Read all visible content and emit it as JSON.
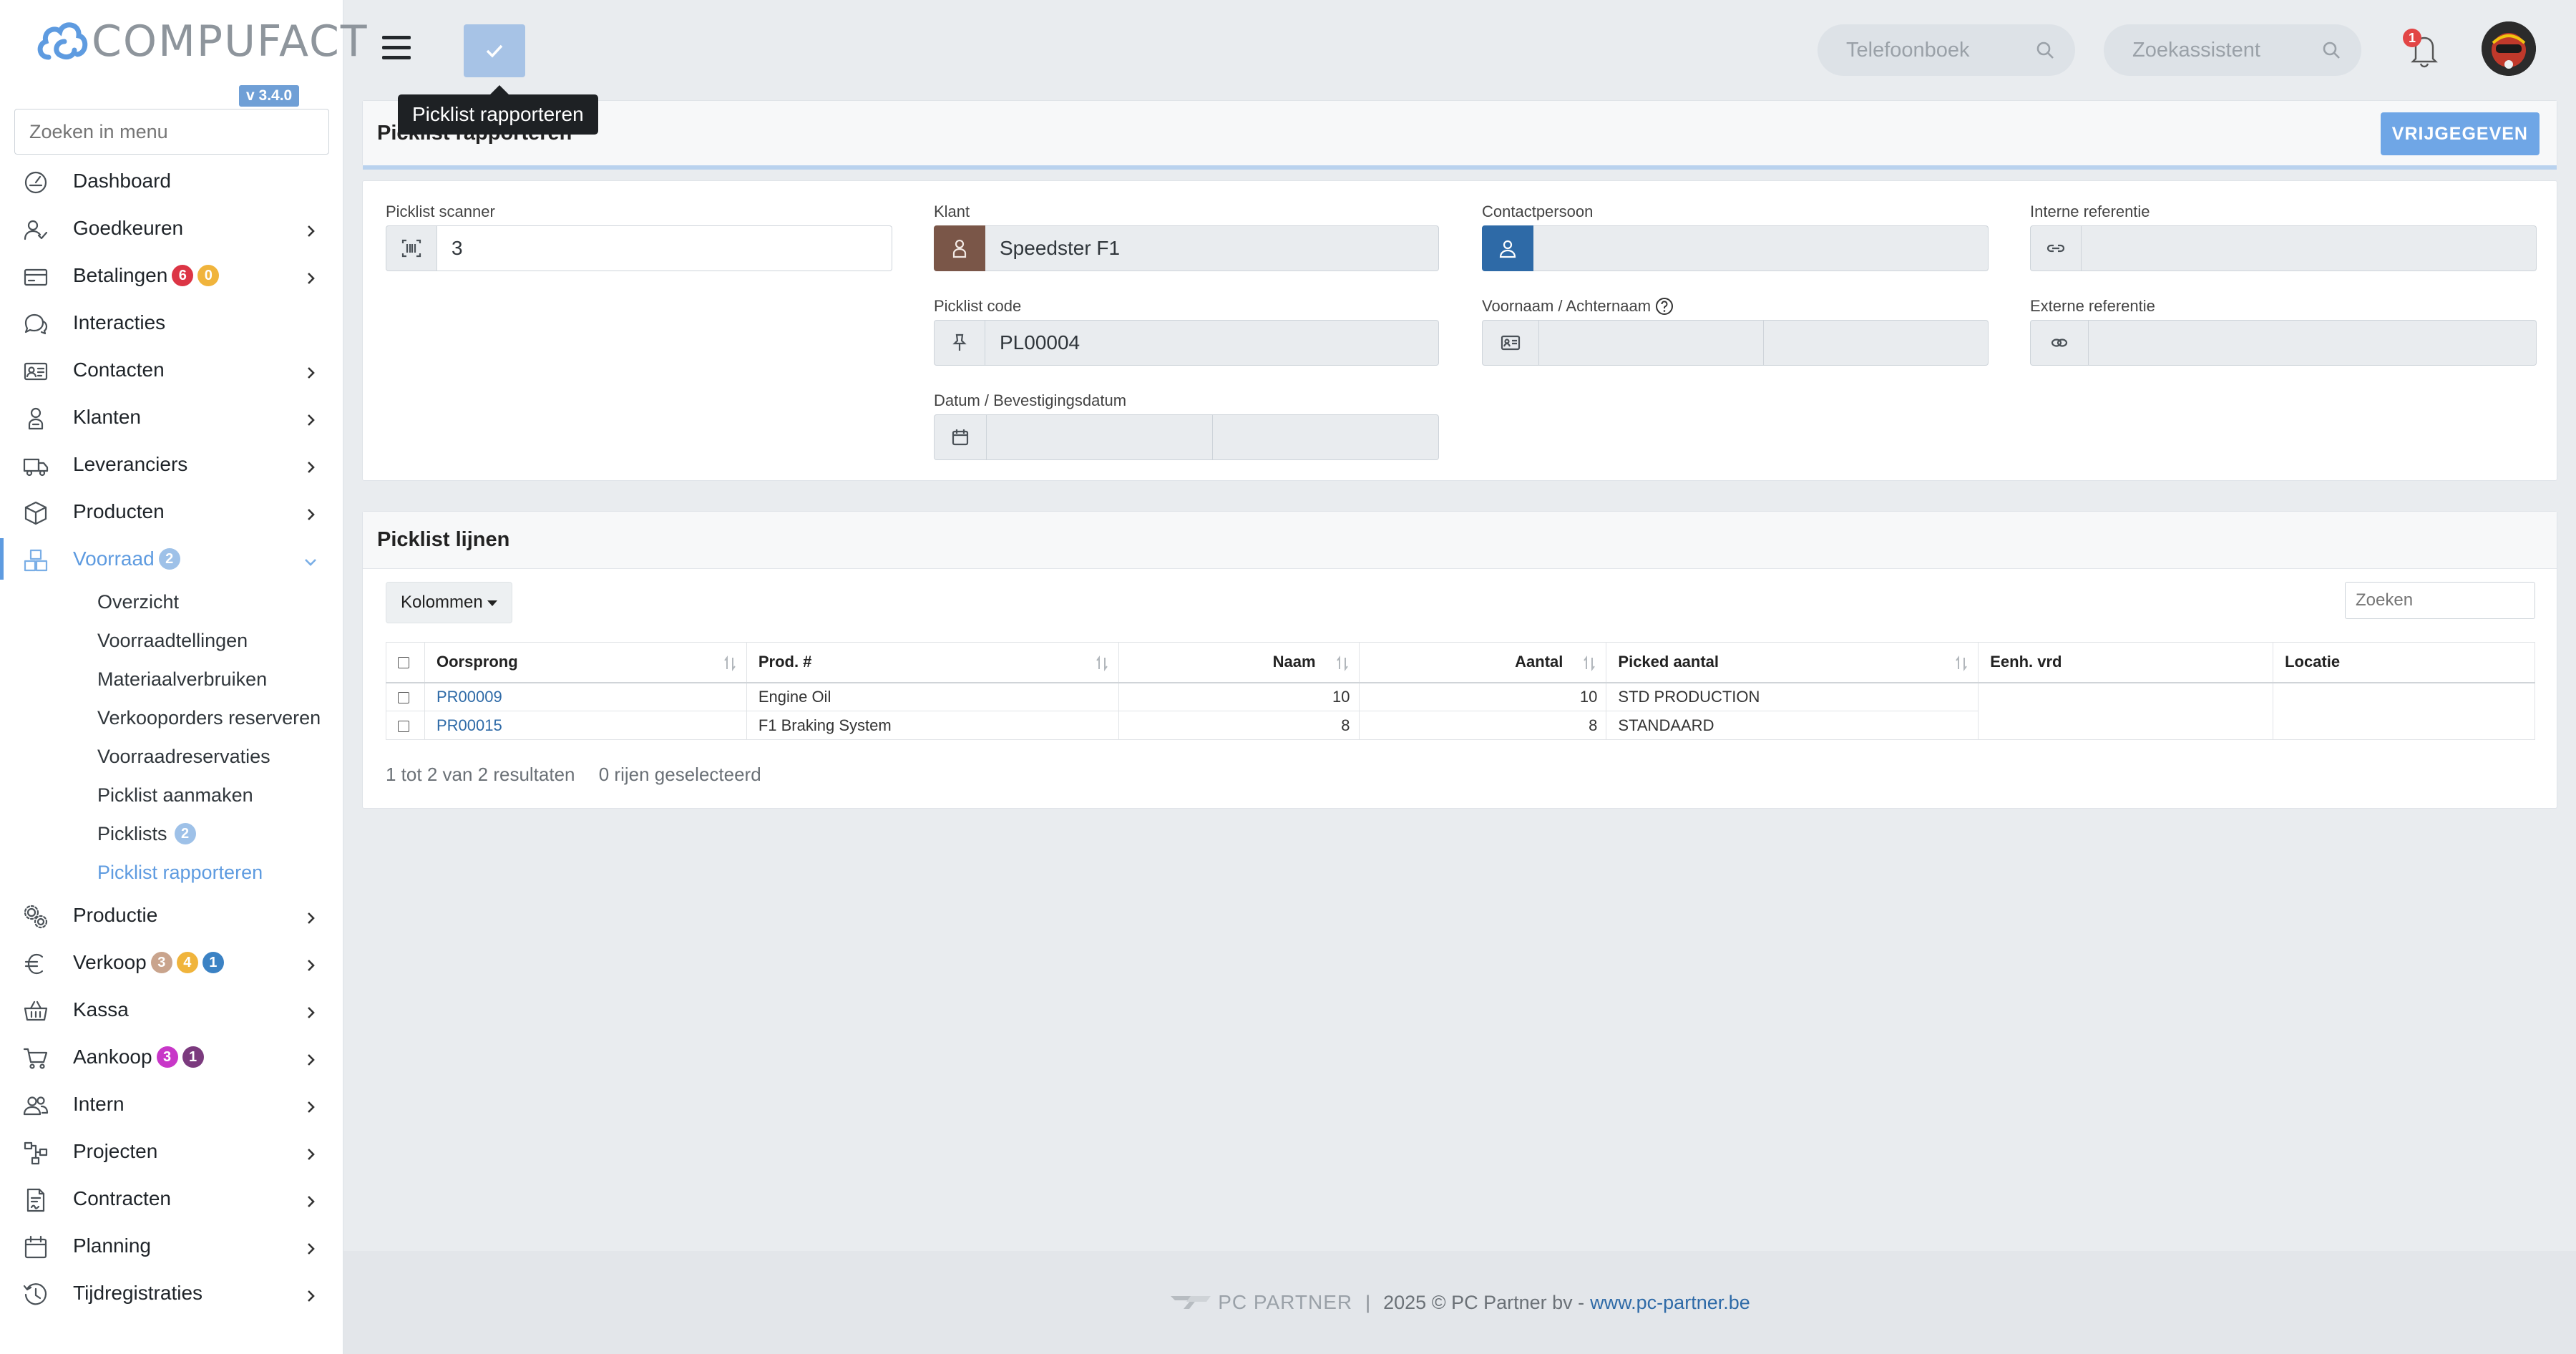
{
  "app": {
    "brand": "COMPUFACT",
    "version": "v 3.4.0",
    "menu_search_placeholder": "Zoeken in menu"
  },
  "sidebar": {
    "items": [
      {
        "key": "dashboard",
        "label": "Dashboard",
        "icon": "dashboard-icon",
        "chevron": false
      },
      {
        "key": "goedkeuren",
        "label": "Goedkeuren",
        "icon": "user-check-icon",
        "chevron": true
      },
      {
        "key": "betalingen",
        "label": "Betalingen",
        "icon": "credit-card-icon",
        "chevron": true,
        "badges": [
          {
            "text": "6",
            "color": "#dc3545"
          },
          {
            "text": "0",
            "color": "#f0b43c"
          }
        ]
      },
      {
        "key": "interacties",
        "label": "Interacties",
        "icon": "chat-icon",
        "chevron": false
      },
      {
        "key": "contacten",
        "label": "Contacten",
        "icon": "contact-card-icon",
        "chevron": true
      },
      {
        "key": "klanten",
        "label": "Klanten",
        "icon": "customer-icon",
        "chevron": true
      },
      {
        "key": "leveranciers",
        "label": "Leveranciers",
        "icon": "truck-icon",
        "chevron": true
      },
      {
        "key": "producten",
        "label": "Producten",
        "icon": "box-icon",
        "chevron": true
      },
      {
        "key": "voorraad",
        "label": "Voorraad",
        "icon": "boxes-icon",
        "chevron": true,
        "active": true,
        "badges": [
          {
            "text": "2",
            "color": "#9ec1e8"
          }
        ]
      }
    ],
    "voorraad_sub": [
      {
        "label": "Overzicht"
      },
      {
        "label": "Voorraadtellingen"
      },
      {
        "label": "Materiaalverbruiken"
      },
      {
        "label": "Verkooporders reserveren"
      },
      {
        "label": "Voorraadreservaties"
      },
      {
        "label": "Picklist aanmaken"
      },
      {
        "label": "Picklists",
        "badge": "2"
      },
      {
        "label": "Picklist rapporteren",
        "current": true
      }
    ],
    "items_after": [
      {
        "key": "productie",
        "label": "Productie",
        "icon": "gears-icon",
        "chevron": true
      },
      {
        "key": "verkoop",
        "label": "Verkoop",
        "icon": "euro-icon",
        "chevron": true,
        "badges": [
          {
            "text": "3",
            "color": "#c9a48d"
          },
          {
            "text": "4",
            "color": "#f0b43c"
          },
          {
            "text": "1",
            "color": "#3b82c4"
          }
        ]
      },
      {
        "key": "kassa",
        "label": "Kassa",
        "icon": "basket-icon",
        "chevron": true
      },
      {
        "key": "aankoop",
        "label": "Aankoop",
        "icon": "cart-icon",
        "chevron": true,
        "badges": [
          {
            "text": "3",
            "color": "#c837c8"
          },
          {
            "text": "1",
            "color": "#7b3a7e"
          }
        ]
      },
      {
        "key": "intern",
        "label": "Intern",
        "icon": "users-icon",
        "chevron": true
      },
      {
        "key": "projecten",
        "label": "Projecten",
        "icon": "project-icon",
        "chevron": true
      },
      {
        "key": "contracten",
        "label": "Contracten",
        "icon": "contract-icon",
        "chevron": true
      },
      {
        "key": "planning",
        "label": "Planning",
        "icon": "calendar-icon",
        "chevron": true
      },
      {
        "key": "tijdregistraties",
        "label": "Tijdregistraties",
        "icon": "clock-icon",
        "chevron": true
      }
    ]
  },
  "topbar": {
    "tooltip": "Picklist rapporteren",
    "phonebook_placeholder": "Telefoonboek",
    "assistant_placeholder": "Zoekassistent",
    "notifications_count": "1"
  },
  "header_panel": {
    "title": "Picklist rapporteren",
    "release_button": "VRIJGEGEVEN"
  },
  "form": {
    "scanner_label": "Picklist scanner",
    "scanner_value": "3",
    "klant_label": "Klant",
    "klant_value": "Speedster F1",
    "contact_label": "Contactpersoon",
    "contact_value": "",
    "interne_ref_label": "Interne referentie",
    "interne_ref_value": "",
    "picklist_code_label": "Picklist code",
    "picklist_code_value": "PL00004",
    "name_label": "Voornaam / Achternaam",
    "firstname_value": "",
    "lastname_value": "",
    "externe_ref_label": "Externe referentie",
    "externe_ref_value": "",
    "date_label": "Datum / Bevestigingsdatum",
    "date_value": "",
    "confirm_date_value": ""
  },
  "lines_panel": {
    "title": "Picklist lijnen",
    "columns_button": "Kolommen",
    "search_placeholder": "Zoeken",
    "headers": [
      "Oorsprong",
      "Prod. #",
      "Naam",
      "Aantal",
      "Picked aantal",
      "Eenh. vrd",
      "Locatie"
    ],
    "rows": [
      {
        "oorsprong": "PR00009",
        "prod": "Engine Oil",
        "naam": "10",
        "aantal": "10",
        "picked": "STD PRODUCTION"
      },
      {
        "oorsprong": "PR00015",
        "prod": "F1 Braking System",
        "naam": "8",
        "aantal": "8",
        "picked": "STANDAARD"
      }
    ],
    "result_info": "1 tot 2 van 2 resultaten",
    "selected_info": "0 rijen geselecteerd"
  },
  "footer": {
    "brand": "PC PARTNER",
    "copyright": "2025 © PC Partner bv -",
    "link": "www.pc-partner.be"
  }
}
